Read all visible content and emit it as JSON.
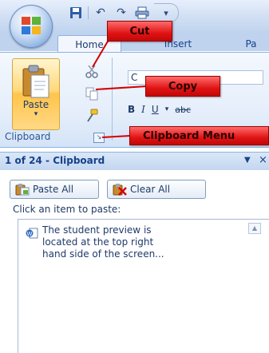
{
  "title_bar": {
    "office_button_icon": "office-logo-icon",
    "quick_access": [
      "save-icon",
      "undo-icon",
      "redo-icon",
      "print-icon",
      "customize-icon"
    ]
  },
  "tabs": [
    {
      "label": "Home"
    },
    {
      "label": "Insert"
    },
    {
      "label": "Pa"
    }
  ],
  "ribbon": {
    "paste_label": "Paste",
    "group_label": "Clipboard",
    "font_name": "C",
    "format_buttons": [
      "B",
      "I",
      "U",
      "abc"
    ]
  },
  "callouts": {
    "cut": "Cut",
    "copy": "Copy",
    "clipboard_menu": "Clipboard Menu"
  },
  "clipboard_pane": {
    "title": "1 of 24 - Clipboard",
    "paste_all": "Paste All",
    "clear_all": "Clear All",
    "instruction": "Click an item to paste:",
    "items": [
      {
        "lines": [
          "The student preview is",
          "located at the top right",
          "hand side of the screen..."
        ]
      }
    ]
  },
  "colors": {
    "callout_red": "#e01414",
    "ribbon_blue": "#15428b",
    "paste_gold": "#ffc44a"
  }
}
